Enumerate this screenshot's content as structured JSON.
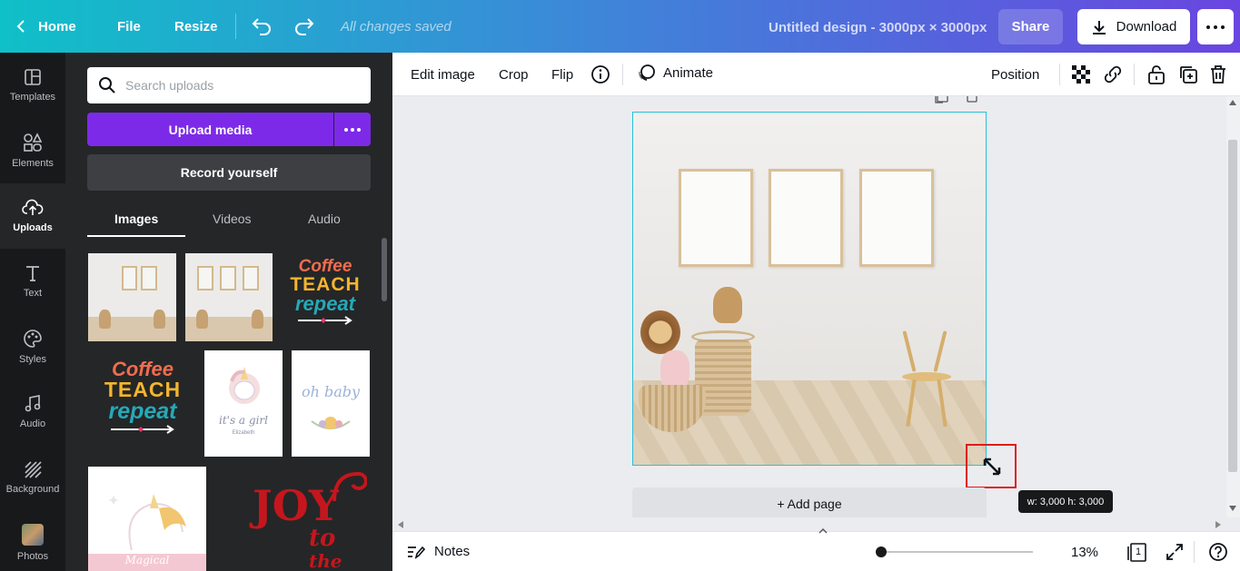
{
  "topbar": {
    "home": "Home",
    "file": "File",
    "resize": "Resize",
    "saved_status": "All changes saved",
    "design_title": "Untitled design - 3000px × 3000px",
    "share": "Share",
    "download": "Download"
  },
  "rail": {
    "items": [
      {
        "label": "Templates",
        "icon": "templates-icon"
      },
      {
        "label": "Elements",
        "icon": "elements-icon"
      },
      {
        "label": "Uploads",
        "icon": "uploads-icon"
      },
      {
        "label": "Text",
        "icon": "text-icon"
      },
      {
        "label": "Styles",
        "icon": "styles-icon"
      },
      {
        "label": "Audio",
        "icon": "audio-icon"
      },
      {
        "label": "Background",
        "icon": "background-icon"
      },
      {
        "label": "Photos",
        "icon": "photos-icon"
      }
    ],
    "active": "Uploads"
  },
  "panel": {
    "search_placeholder": "Search uploads",
    "upload_media": "Upload media",
    "record_yourself": "Record yourself",
    "tabs": [
      "Images",
      "Videos",
      "Audio"
    ],
    "active_tab": "Images",
    "coffee_lines": [
      "Coffee",
      "TEACH",
      "repeat"
    ],
    "girl_text": "it's a girl",
    "girl_name": "Elizabeth",
    "baby_text": "oh baby",
    "magical_text": "Magical",
    "joy_lines": [
      "JOY",
      "to",
      "the"
    ]
  },
  "context_toolbar": {
    "edit_image": "Edit image",
    "crop": "Crop",
    "flip": "Flip",
    "animate": "Animate",
    "position": "Position"
  },
  "canvas": {
    "add_page": "+ Add page",
    "size_tooltip": "w: 3,000 h: 3,000"
  },
  "footer": {
    "notes": "Notes",
    "zoom": "13%",
    "page_count": "1"
  },
  "colors": {
    "accent_purple": "#7d2ae8",
    "selection_cyan": "#27c0d6",
    "highlight_red": "#e01b1b"
  }
}
